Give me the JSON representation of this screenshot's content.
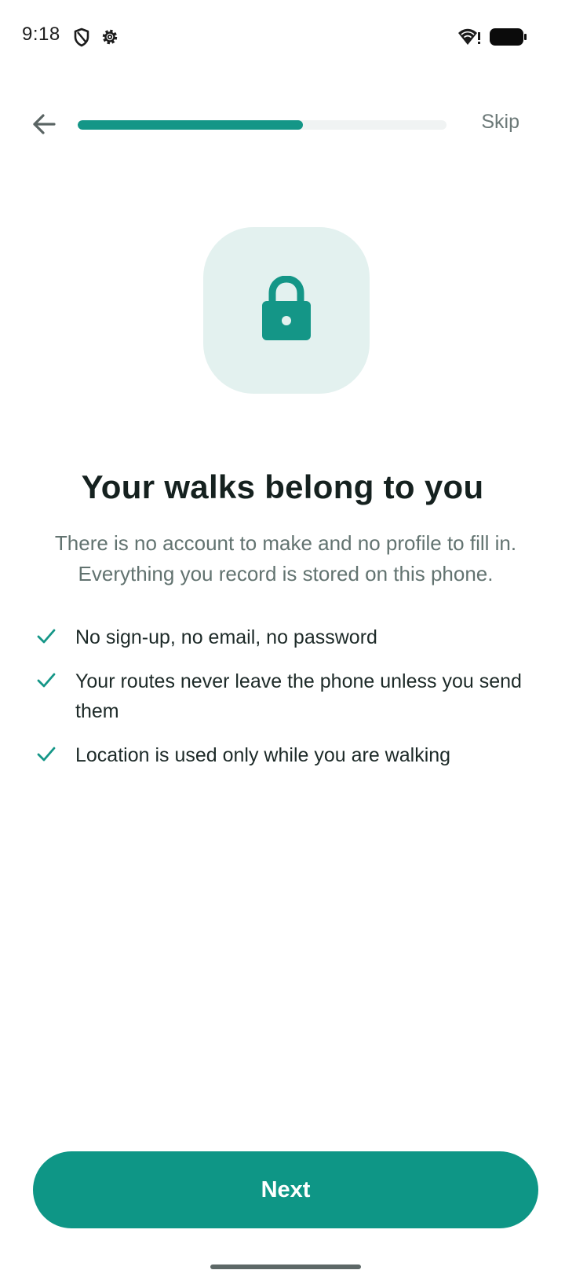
{
  "status_bar": {
    "time": "9:18",
    "icons": [
      "shield-icon",
      "gear-icon",
      "wifi-alert-icon",
      "battery-icon"
    ]
  },
  "top_bar": {
    "back_icon": "arrow-left-icon",
    "skip_label": "Skip",
    "progress_fraction": 0.61
  },
  "hero": {
    "icon": "lock-icon"
  },
  "content": {
    "headline": "Your walks belong to you",
    "subtext": "There is no account to make and no profile to fill in. Everything you record is stored on this phone.",
    "features": [
      "No sign-up, no email, no password",
      "Your routes never leave the phone unless you send them",
      "Location is used only while you are walking"
    ]
  },
  "footer": {
    "next_label": "Next"
  },
  "colors": {
    "accent": "#0e9686",
    "hero_background": "#e3f1ef",
    "progress_track": "#f0f3f3"
  }
}
